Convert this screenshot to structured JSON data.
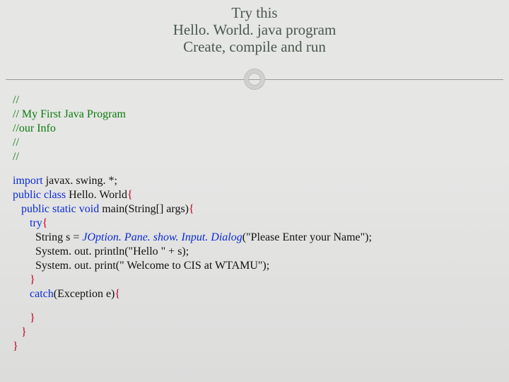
{
  "title": {
    "line1": "Try this",
    "line2": "Hello. World. java program",
    "line3": "Create, compile and run"
  },
  "code": {
    "c1": "//",
    "c2": "// My First Java Program",
    "c3": "//our Info",
    "c4": "//",
    "c5": "//",
    "imp1": "import ",
    "imp2": "javax. swing. *;",
    "pc1": "public class ",
    "pc2": "Hello. World",
    "pc3": "{",
    "main1": "   public static void ",
    "main2": "main(String[] args)",
    "main3": "{",
    "try1": "      try",
    "try2": "{",
    "s1a": "        String s = ",
    "s1b": "JOption. Pane. show. Input. Dialog",
    "s1c": "(\"Please Enter your Name\");",
    "s2": "        System. out. println(\"Hello \" + s);",
    "s3": "        System. out. print(\" Welcome to CIS at WTAMU\");",
    "brace_try_close": "      }",
    "catch1": "      catch",
    "catch2": "(Exception e)",
    "catch3": "{",
    "brace_catch_close": "      }",
    "brace_main_close": "   }",
    "brace_class_close": "}"
  }
}
